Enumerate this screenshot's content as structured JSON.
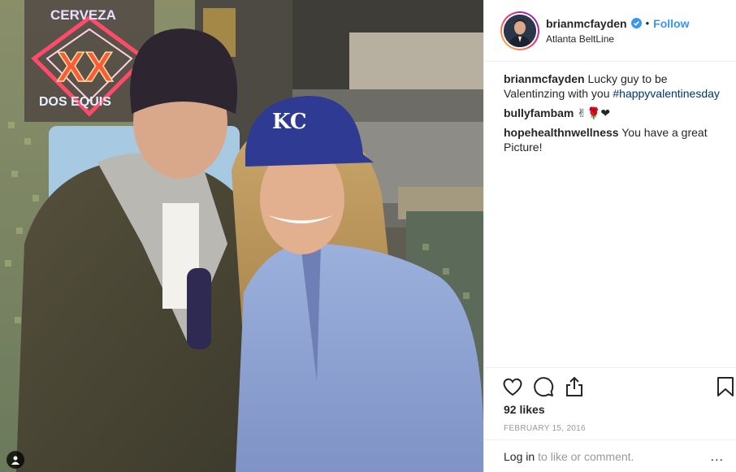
{
  "post": {
    "photo_alt": "Photo of a man in a beanie and a woman in a KC cap",
    "neon_sign": {
      "line1": "CERVEZA",
      "line2": "XX",
      "line3": "DOS EQUIS"
    },
    "cap_logo": "KC"
  },
  "header": {
    "username": "brianmcfayden",
    "verified_icon": "verified-badge-icon",
    "separator": "•",
    "follow_label": "Follow",
    "location": "Atlanta BeltLine"
  },
  "comments": [
    {
      "user": "brianmcfayden",
      "text": "Lucky guy to be Valentinzing with you ",
      "hashtag": "#happyvalentinesday"
    },
    {
      "user": "bullyfambam",
      "text": "✌🌹❤"
    },
    {
      "user": "hopehealthnwellness",
      "text": "You have a great Picture!"
    }
  ],
  "actions": {
    "icons": [
      "heart-icon",
      "comment-icon",
      "share-icon",
      "bookmark-icon"
    ]
  },
  "likes": "92 likes",
  "date": "FEBRUARY 15, 2016",
  "footer": {
    "login_label": "Log in",
    "login_suffix": "to like or comment.",
    "more_label": "..."
  },
  "colors": {
    "accent": "#3897f0",
    "hashtag": "#003569",
    "text": "#262626",
    "muted": "#999999",
    "border": "#efefef"
  }
}
